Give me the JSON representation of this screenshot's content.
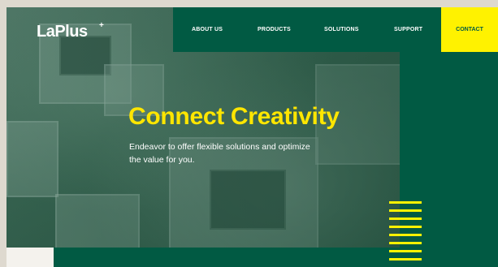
{
  "brand": {
    "name": "LaPlus",
    "plus_mark": "+"
  },
  "nav": {
    "items": [
      "ABOUT US",
      "PRODUCTS",
      "SOLUTIONS",
      "SUPPORT"
    ],
    "contact": "CONTACT"
  },
  "hero": {
    "headline": "Connect Creativity",
    "subtext": "Endeavor to offer flexible solutions and optimize the value for you."
  },
  "colors": {
    "brand_green": "#015a43",
    "accent_yellow": "#fff200",
    "headline_yellow": "#ffe600"
  }
}
